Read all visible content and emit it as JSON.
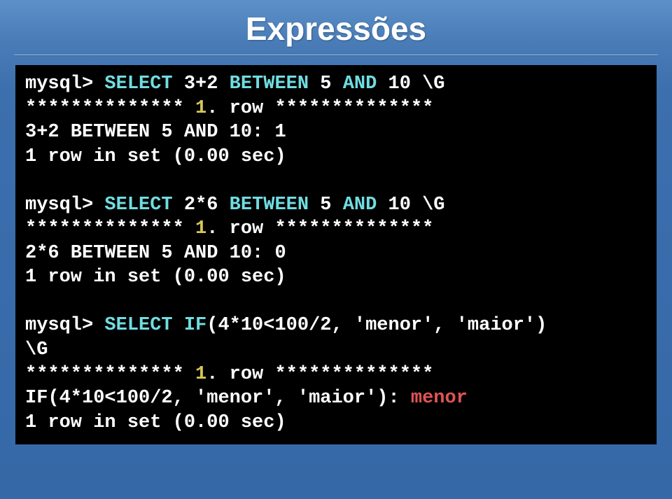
{
  "title": "Expressões",
  "terminal": {
    "blocks": [
      {
        "prompt": "mysql>",
        "select_kw": "SELECT",
        "expr_num": "3+2",
        "between_kw": "BETWEEN",
        "mid": "5",
        "and_kw": "AND",
        "tail": "10 \\G",
        "row_marker_l": "**************",
        "row_marker_v": "1",
        "row_marker_r": ". row **************",
        "result_line": "3+2 BETWEEN 5 AND 10: 1",
        "footer_pre": "1 row in set (0.00 sec)"
      },
      {
        "prompt": "mysql>",
        "select_kw": "SELECT",
        "expr_num": "2*6",
        "between_kw": "BETWEEN",
        "mid": "5",
        "and_kw": "AND",
        "tail": "10 \\G",
        "row_marker_l": "**************",
        "row_marker_v": "1",
        "row_marker_r": ". row **************",
        "result_line": "2*6 BETWEEN 5 AND 10: 0",
        "footer_pre": "1 row in set (0.00 sec)"
      },
      {
        "prompt": "mysql>",
        "select_kw": "SELECT",
        "if_kw": "IF",
        "if_args": "(4*10<100/2, 'menor', 'maior')",
        "tail2": "\\G",
        "row_marker_l": "**************",
        "row_marker_v": "1",
        "row_marker_r": ". row **************",
        "result_pre": "IF(4*10<100/2, 'menor', 'maior'): ",
        "result_val": "menor",
        "footer_pre": "1 row in set (0.00 sec)"
      }
    ]
  }
}
